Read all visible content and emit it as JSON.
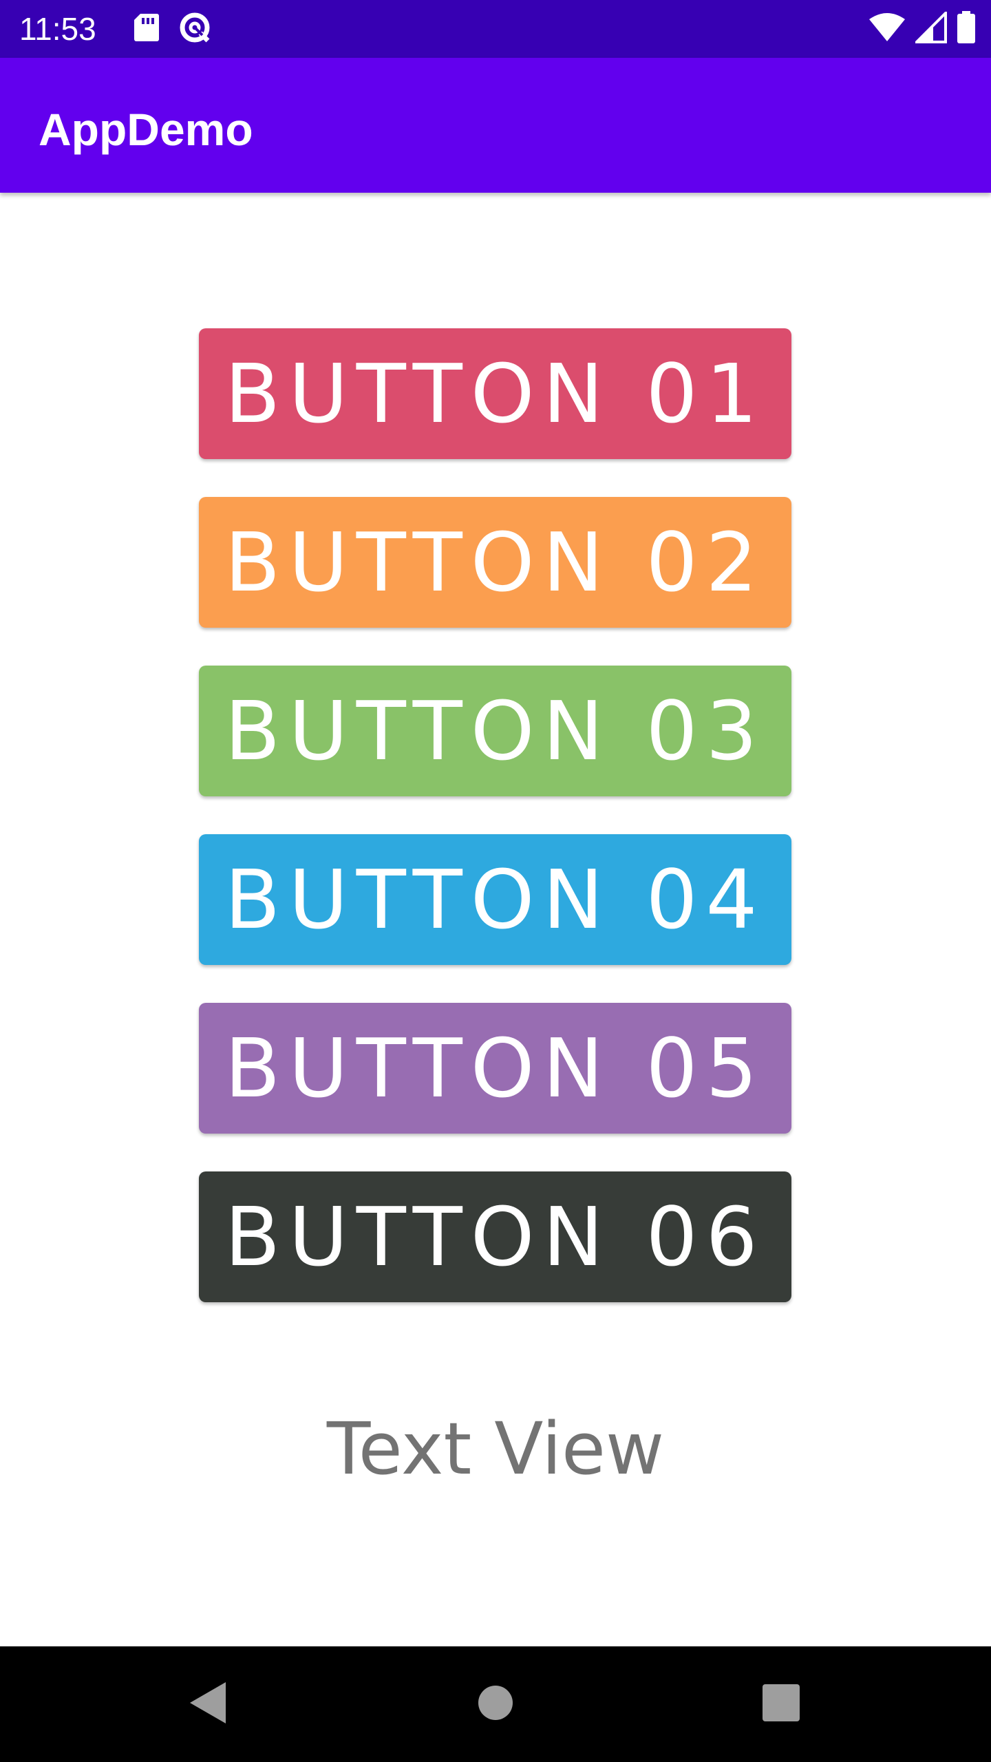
{
  "status_bar": {
    "time": "11:53",
    "background": "#3700b3",
    "left_icons": [
      "sd-card-icon",
      "data-saver-icon"
    ],
    "right_icons": [
      "wifi-icon",
      "cellular-signal-icon",
      "battery-icon"
    ]
  },
  "app_bar": {
    "title": "AppDemo",
    "background": "#6200ee"
  },
  "buttons": [
    {
      "label": "BUTTON 01",
      "color": "#db4d6d"
    },
    {
      "label": "BUTTON 02",
      "color": "#fb9e4f"
    },
    {
      "label": "BUTTON 03",
      "color": "#89c268"
    },
    {
      "label": "BUTTON 04",
      "color": "#2ea9df"
    },
    {
      "label": "BUTTON 05",
      "color": "#986db2"
    },
    {
      "label": "BUTTON 06",
      "color": "#373c38"
    }
  ],
  "text_view": {
    "text": "Text View",
    "color": "#737373"
  },
  "nav_bar": {
    "background": "#000000",
    "icons": [
      "back-icon",
      "home-icon",
      "recents-icon"
    ]
  }
}
